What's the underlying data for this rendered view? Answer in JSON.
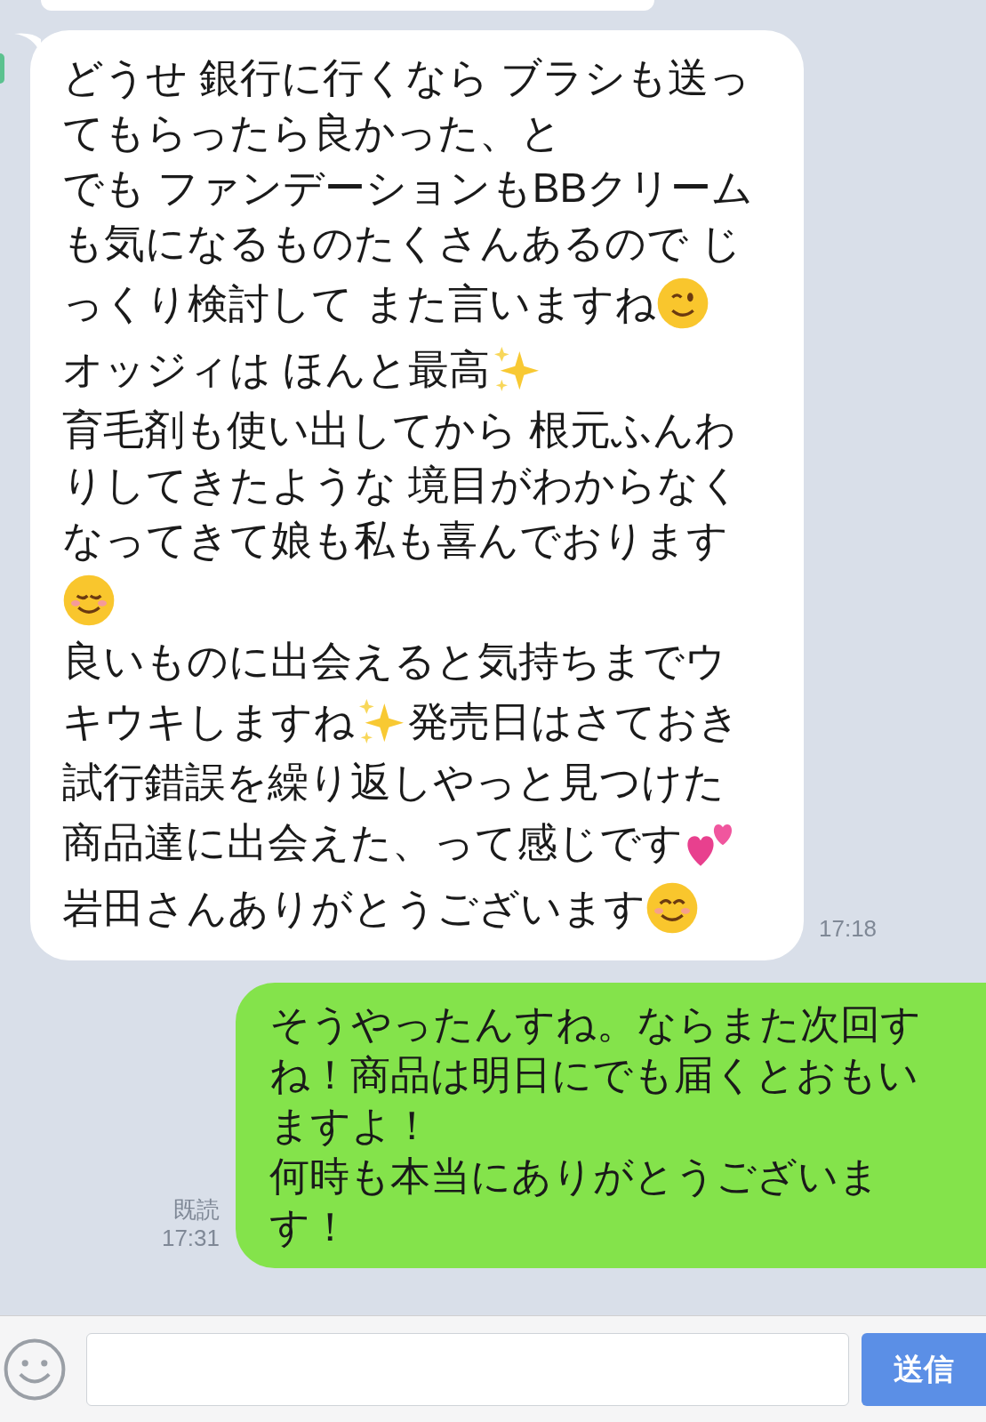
{
  "messages": [
    {
      "kind": "received",
      "time": "17:18",
      "lines": [
        [
          {
            "kind": "text",
            "text": "どうせ 銀行に行くなら ブラシも送っ"
          }
        ],
        [
          {
            "kind": "text",
            "text": "てもらったら良かった、と"
          }
        ],
        [
          {
            "kind": "text",
            "text": "でも ファンデーションもBBクリーム"
          }
        ],
        [
          {
            "kind": "text",
            "text": "も気になるものたくさんあるので じ"
          }
        ],
        [
          {
            "kind": "text",
            "text": "っくり検討して また言いますね"
          },
          {
            "kind": "wink"
          }
        ],
        [
          {
            "kind": "text",
            "text": "オッジィは ほんと最高"
          },
          {
            "kind": "sparkles"
          }
        ],
        [
          {
            "kind": "text",
            "text": "育毛剤も使い出してから 根元ふんわ"
          }
        ],
        [
          {
            "kind": "text",
            "text": "りしてきたような 境目がわからなく"
          }
        ],
        [
          {
            "kind": "text",
            "text": "なってきて娘も私も喜んでおります"
          }
        ],
        [
          {
            "kind": "blush"
          }
        ],
        [
          {
            "kind": "text",
            "text": "良いものに出会えると気持ちまでウ"
          }
        ],
        [
          {
            "kind": "text",
            "text": "キウキしますね"
          },
          {
            "kind": "sparkles"
          },
          {
            "kind": "text",
            "text": "発売日はさておき"
          }
        ],
        [
          {
            "kind": "text",
            "text": "試行錯誤を繰り返しやっと見つけた"
          }
        ],
        [
          {
            "kind": "text",
            "text": "商品達に出会えた、って感じです"
          },
          {
            "kind": "hearts"
          }
        ],
        [
          {
            "kind": "text",
            "text": "岩田さんありがとうございます"
          },
          {
            "kind": "smile"
          }
        ]
      ]
    },
    {
      "kind": "sent",
      "read": "既読",
      "time": "17:31",
      "lines": [
        [
          {
            "kind": "text",
            "text": "そうやったんすね。ならまた次回す"
          }
        ],
        [
          {
            "kind": "text",
            "text": "ね！商品は明日にでも届くとおもい"
          }
        ],
        [
          {
            "kind": "text",
            "text": "ますよ！"
          }
        ],
        [
          {
            "kind": "text",
            "text": "何時も本当にありがとうございま"
          }
        ],
        [
          {
            "kind": "text",
            "text": "す！"
          }
        ]
      ]
    }
  ],
  "composer": {
    "send_button": "送信"
  }
}
